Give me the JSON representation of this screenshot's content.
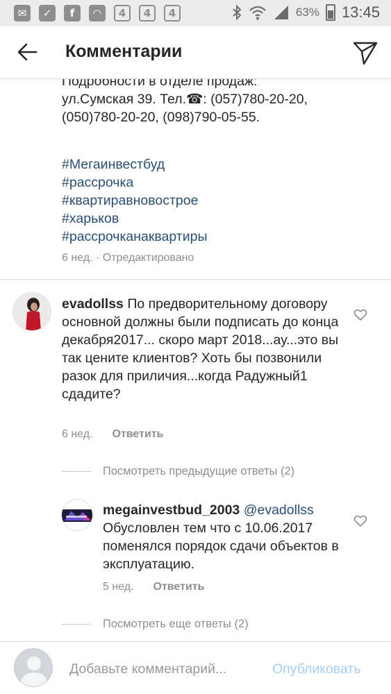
{
  "statusbar": {
    "battery": "63%",
    "time": "13:45",
    "notif_icons": [
      "mail-icon",
      "check-icon",
      "facebook-icon",
      "instagram-icon",
      "app-4-icon",
      "app-4-icon",
      "app-4-icon"
    ]
  },
  "header": {
    "title": "Комментарии"
  },
  "caption": {
    "lines": [
      "Подробности в отделе продаж:",
      "ул.Сумская 39. Тел.☎: (057)780-20-20,",
      "(050)780-20-20, (098)790-05-55."
    ],
    "hashtags": [
      "#Мегаинвестбуд",
      "#рассрочка",
      "#квартиравновострое",
      "#харьков",
      "#рассрочканаквартиры"
    ],
    "meta": "6 нед. · Отредактировано"
  },
  "comments": [
    {
      "username": "evadollss",
      "text": "По предворительному договору основной должны были подписать до конца декабря2017... скоро март 2018...ау...это вы так цените клиентов? Хоть бы позвонили разок для приличия...когда Радужный1 сдадите?",
      "time": "6 нед.",
      "reply_label": "Ответить"
    }
  ],
  "view_previous": "Посмотреть предыдущие ответы (2)",
  "reply_comment": {
    "username": "megainvestbud_2003",
    "mention": "@evadollss",
    "text": "Обусловлен тем что с 10.06.2017 поменялся порядок сдачи объектов в эксплуатацию.",
    "time": "5 нед.",
    "reply_label": "Ответить"
  },
  "view_more": "Посмотреть еще ответы (2)",
  "input": {
    "placeholder": "Добавьте комментарий...",
    "publish_label": "Опубликовать"
  },
  "colors": {
    "hashtag": "#2a4f74",
    "publish_disabled": "#a9cdf0",
    "meta": "#8e8e8e"
  }
}
